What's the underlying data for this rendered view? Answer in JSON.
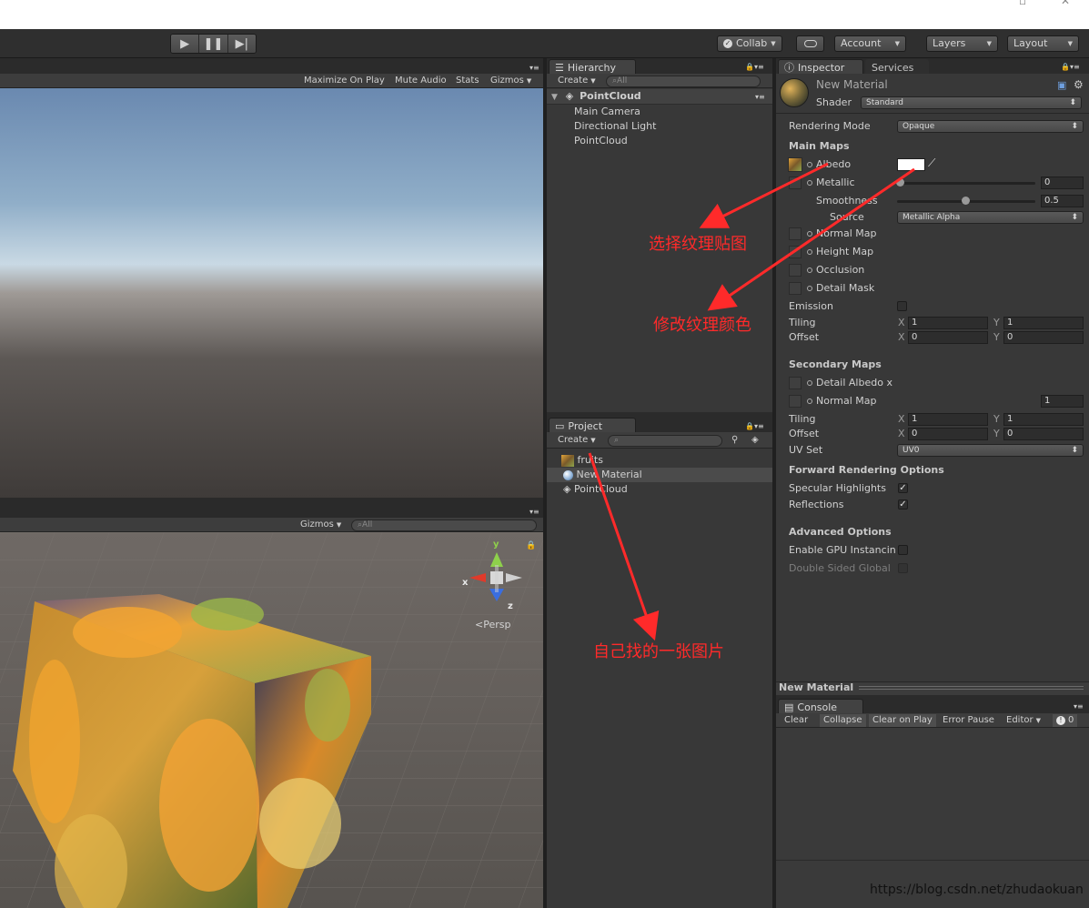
{
  "toolbar": {
    "collab": "Collab",
    "account": "Account",
    "layers": "Layers",
    "layout": "Layout"
  },
  "game": {
    "maximize": "Maximize On Play",
    "mute": "Mute Audio",
    "stats": "Stats",
    "gizmos": "Gizmos"
  },
  "scene": {
    "gizmos": "Gizmos",
    "search_placeholder": "All",
    "axis_y": "y",
    "axis_x": "x",
    "axis_z": "z",
    "persp": "Persp"
  },
  "hierarchy": {
    "tab": "Hierarchy",
    "create": "Create",
    "search_placeholder": "All",
    "scene_name": "PointCloud",
    "items": [
      {
        "label": "Main Camera"
      },
      {
        "label": "Directional Light"
      },
      {
        "label": "PointCloud"
      }
    ]
  },
  "project": {
    "tab": "Project",
    "create": "Create",
    "items": [
      {
        "label": "fruits"
      },
      {
        "label": "New Material"
      },
      {
        "label": "PointCloud"
      }
    ]
  },
  "inspector": {
    "tab": "Inspector",
    "tab_services": "Services",
    "material_name": "New Material",
    "shader_label": "Shader",
    "shader_value": "Standard",
    "rendering_mode_label": "Rendering Mode",
    "rendering_mode_value": "Opaque",
    "main_maps": "Main Maps",
    "albedo": "Albedo",
    "metallic": "Metallic",
    "metallic_value": "0",
    "smoothness": "Smoothness",
    "smoothness_value": "0.5",
    "source": "Source",
    "source_value": "Metallic Alpha",
    "normal_map": "Normal Map",
    "height_map": "Height Map",
    "occlusion": "Occlusion",
    "detail_mask": "Detail Mask",
    "emission": "Emission",
    "tiling": "Tiling",
    "offset": "Offset",
    "x": "X",
    "y": "Y",
    "tiling_x": "1",
    "tiling_y": "1",
    "offset_x": "0",
    "offset_y": "0",
    "secondary_maps": "Secondary Maps",
    "detail_albedo": "Detail Albedo x",
    "normal_map2": "Normal Map",
    "normal_map2_value": "1",
    "tiling2_x": "1",
    "tiling2_y": "1",
    "offset2_x": "0",
    "offset2_y": "0",
    "uv_set": "UV Set",
    "uv_set_value": "UV0",
    "forward_rendering": "Forward Rendering Options",
    "specular_highlights": "Specular Highlights",
    "reflections": "Reflections",
    "advanced_options": "Advanced Options",
    "gpu_instancing": "Enable GPU Instancin",
    "double_sided": "Double Sided Global",
    "footer": "New Material"
  },
  "console": {
    "tab": "Console",
    "clear": "Clear",
    "collapse": "Collapse",
    "clear_on_play": "Clear on Play",
    "error_pause": "Error Pause",
    "editor": "Editor",
    "count": "0"
  },
  "annotations": {
    "select_texture": "选择纹理贴图",
    "change_color": "修改纹理颜色",
    "own_image": "自己找的一张图片",
    "color": "#ff2a2a"
  },
  "watermark": "https://blog.csdn.net/zhudaokuan"
}
